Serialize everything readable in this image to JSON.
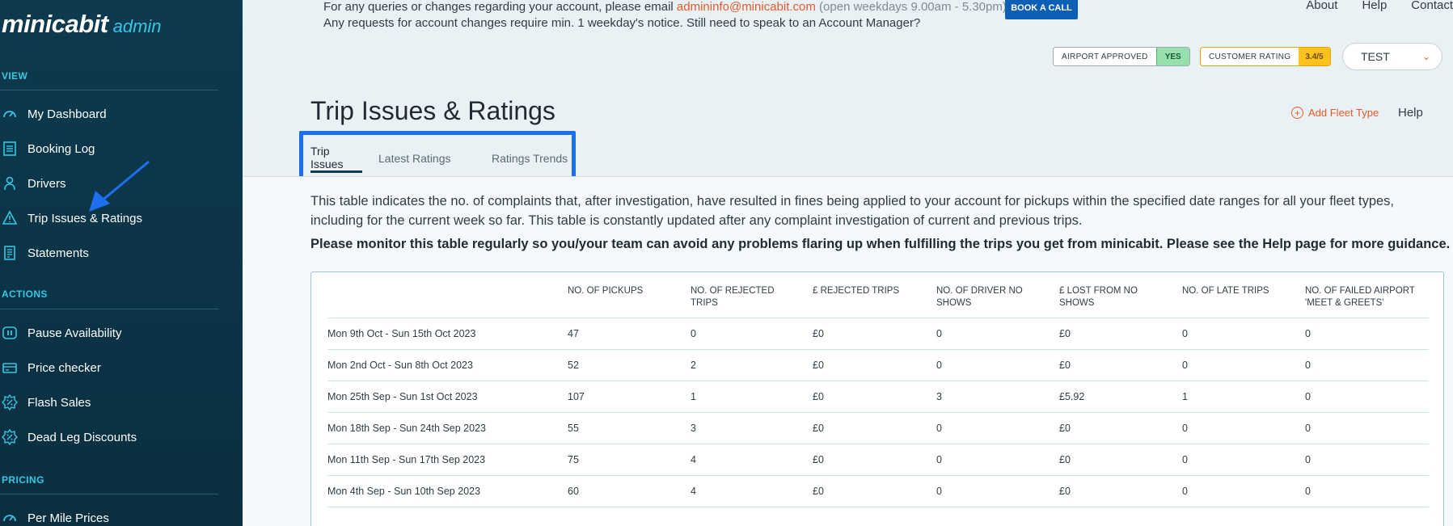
{
  "sidebar": {
    "logo_main": "minicabit",
    "logo_sub": "admin",
    "sections": {
      "view": "VIEW",
      "actions": "ACTIONS",
      "pricing": "PRICING"
    },
    "view_items": [
      {
        "label": "My Dashboard",
        "icon": "speedometer-icon"
      },
      {
        "label": "Booking Log",
        "icon": "list-icon"
      },
      {
        "label": "Drivers",
        "icon": "driver-icon"
      },
      {
        "label": "Trip Issues & Ratings",
        "icon": "warning-icon"
      },
      {
        "label": "Statements",
        "icon": "statement-icon"
      }
    ],
    "action_items": [
      {
        "label": "Pause Availability",
        "icon": "pause-icon"
      },
      {
        "label": "Price checker",
        "icon": "price-tag-icon"
      },
      {
        "label": "Flash Sales",
        "icon": "percent-icon"
      },
      {
        "label": "Dead Leg Discounts",
        "icon": "percent-icon"
      }
    ],
    "pricing_items": [
      {
        "label": "Per Mile Prices",
        "icon": "speedometer-icon"
      }
    ]
  },
  "header": {
    "notice_line1_prefix": "For any queries or changes regarding your account, please email ",
    "notice_email": "admininfo@minicabit.com",
    "notice_hours": " (open weekdays 9.00am - 5.30pm)",
    "notice_line2": "Any requests for account changes require min. 1 weekday's notice. Still need to speak to an Account Manager?",
    "book_call": "BOOK A CALL",
    "links": [
      "About",
      "Help",
      "Contact"
    ],
    "airport_label": "AIRPORT APPROVED",
    "airport_value": "YES",
    "rating_label": "CUSTOMER RATING",
    "rating_value": "3.4/5",
    "account_select": "TEST"
  },
  "page": {
    "title": "Trip Issues & Ratings",
    "add_fleet": "Add Fleet Type",
    "help": "Help",
    "tabs": [
      "Trip Issues",
      "Latest Ratings",
      "Ratings Trends"
    ],
    "description": "This table indicates the no. of complaints that, after investigation, have resulted in fines being applied to your account for pickups within the specified date ranges for all your fleet types, including for the current week so far. This table is constantly updated after any complaint investigation of current and previous trips.",
    "guidance": "Please monitor this table regularly so you/your team can avoid any problems flaring up when fulfilling the trips you get from minicabit. Please see the Help page for more guidance."
  },
  "table": {
    "headers": [
      "NO. OF PICKUPS",
      "NO. OF REJECTED TRIPS",
      "£ REJECTED TRIPS",
      "NO. OF DRIVER NO SHOWS",
      "£ LOST FROM NO SHOWS",
      "NO. OF LATE TRIPS",
      "NO. OF FAILED AIRPORT 'MEET & GREETS'"
    ],
    "rows": [
      [
        "Mon 9th Oct - Sun 15th Oct 2023",
        "47",
        "0",
        "£0",
        "0",
        "£0",
        "0",
        "0"
      ],
      [
        "Mon 2nd Oct - Sun 8th Oct 2023",
        "52",
        "2",
        "£0",
        "0",
        "£0",
        "0",
        "0"
      ],
      [
        "Mon 25th Sep - Sun 1st Oct 2023",
        "107",
        "1",
        "£0",
        "3",
        "£5.92",
        "1",
        "0"
      ],
      [
        "Mon 18th Sep - Sun 24th Sep 2023",
        "55",
        "3",
        "£0",
        "0",
        "£0",
        "0",
        "0"
      ],
      [
        "Mon 11th Sep - Sun 17th Sep 2023",
        "75",
        "4",
        "£0",
        "0",
        "£0",
        "0",
        "0"
      ],
      [
        "Mon 4th Sep - Sun 10th Sep 2023",
        "60",
        "4",
        "£0",
        "0",
        "£0",
        "0",
        "0"
      ]
    ]
  }
}
